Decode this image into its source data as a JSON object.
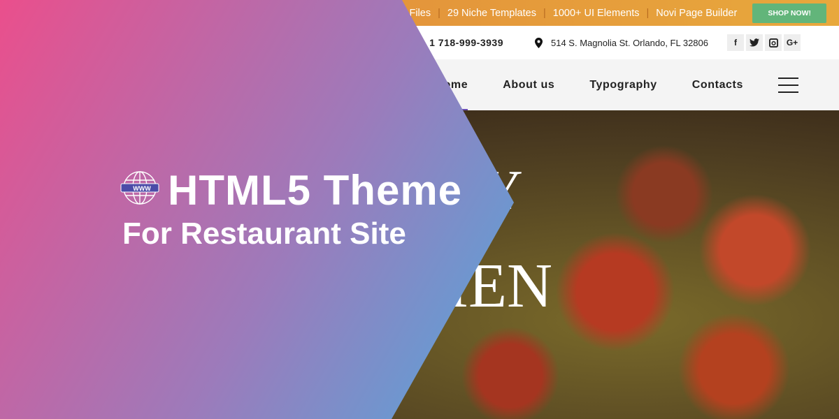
{
  "topbar": {
    "items": [
      "L Files",
      "29 Niche Templates",
      "1000+ UI Elements",
      "Novi Page Builder"
    ],
    "shop_label": "SHOP NOW!"
  },
  "contact": {
    "phone": "1 718-999-3939",
    "address": "514 S. Magnolia St. Orlando, FL 32806",
    "social": [
      "f",
      "t",
      "ig",
      "G+"
    ]
  },
  "nav": {
    "items": [
      "Home",
      "About us",
      "Typography",
      "Contacts"
    ],
    "active": "Home"
  },
  "hero": {
    "fragment_top": "Y",
    "fragment_bottom": "IEN"
  },
  "banner": {
    "title": "HTML5 Theme",
    "subtitle": "For Restaurant Site",
    "icon_text": "WWW"
  },
  "colors": {
    "gradient_start": "#ea4f8c",
    "gradient_end": "#47aee0",
    "shop": "#62b57a",
    "nav_active": "#6b4db5"
  }
}
